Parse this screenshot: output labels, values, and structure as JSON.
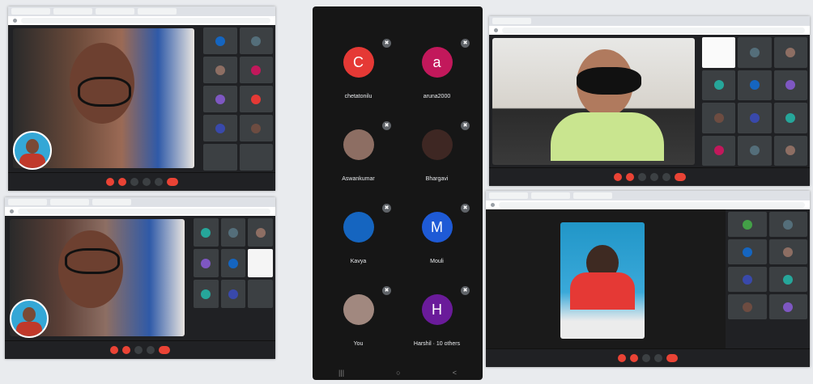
{
  "colors": {
    "meet_dark": "#202124",
    "tile_grey": "#3c4043",
    "end_red": "#ea4335",
    "avatar_red": "#e53935",
    "avatar_magenta": "#c2185b",
    "avatar_blue": "#1e5ad6",
    "avatar_purple": "#6a1b9a"
  },
  "phone": {
    "participants": [
      {
        "name": "chetatonilu",
        "initial": "C",
        "color": "#e53935",
        "kind": "letter"
      },
      {
        "name": "aruna2000",
        "initial": "a",
        "color": "#c2185b",
        "kind": "letter"
      },
      {
        "name": "Aswankumar",
        "initial": "",
        "color": "#8d6e63",
        "kind": "photo"
      },
      {
        "name": "Bhargavi",
        "initial": "",
        "color": "#3e2723",
        "kind": "photo"
      },
      {
        "name": "Kavya",
        "initial": "",
        "color": "#1565c0",
        "kind": "photo"
      },
      {
        "name": "Mouli",
        "initial": "M",
        "color": "#1e5ad6",
        "kind": "letter"
      },
      {
        "name": "You",
        "initial": "",
        "color": "#a1887f",
        "kind": "photo"
      },
      {
        "name": "Harshil · 10 others",
        "initial": "H",
        "color": "#6a1b9a",
        "kind": "letter"
      }
    ],
    "nav_icons": [
      "back-icon",
      "home-icon",
      "recents-icon",
      "keyboard-icon"
    ]
  }
}
